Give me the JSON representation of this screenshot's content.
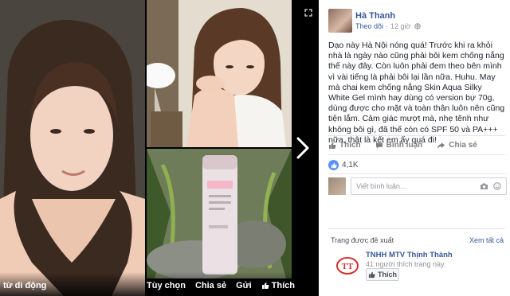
{
  "viewer": {
    "caption": "từ di động",
    "actions": [
      "Tùy chọn",
      "Chia sẻ",
      "Gửi",
      "Thích"
    ],
    "photos": [
      {
        "description_icon": "portrait-photo"
      },
      {
        "description_icon": "portrait-photo"
      },
      {
        "description_icon": "product-photo"
      }
    ]
  },
  "post": {
    "author": "Hà Thanh",
    "follow": "Theo dõi",
    "time": "12 giờ",
    "text": "Dạo này Hà Nội nóng quá! Trước khi ra khỏi nhà là ngày nào cũng phải bôi kem chống nắng thế này đây. Còn luôn phải đem theo bên mình vì vài tiếng là phải bôi lại lần nữa. Huhu. May mà chai kem chống nắng Skin Aqua Silky White Gel mình hay dùng có version bự 70g, dùng được cho mặt và toàn thân luôn nên cũng tiện lắm. Cảm giác mượt mà, nhẹ tênh như không bôi gì, đã thế còn có SPF 50 và PA+++ nữa, thật là kết em ấy quá đi!",
    "reactions": [
      "Thích",
      "Bình luận",
      "Chia sẻ"
    ],
    "like_count": "4,1K",
    "comment_placeholder": "Viết bình luận..."
  },
  "suggest": {
    "title": "Trang được đề xuất",
    "see_all": "Xem tất cả",
    "page_name": "TNHH MTV Thịnh Thành",
    "page_likes": "41 người thích trang này.",
    "like_button": "Thích",
    "logo_text": "TT"
  },
  "colors": {
    "link": "#365899",
    "like_blue": "#5890ff",
    "logo_red": "#d32f2f"
  }
}
